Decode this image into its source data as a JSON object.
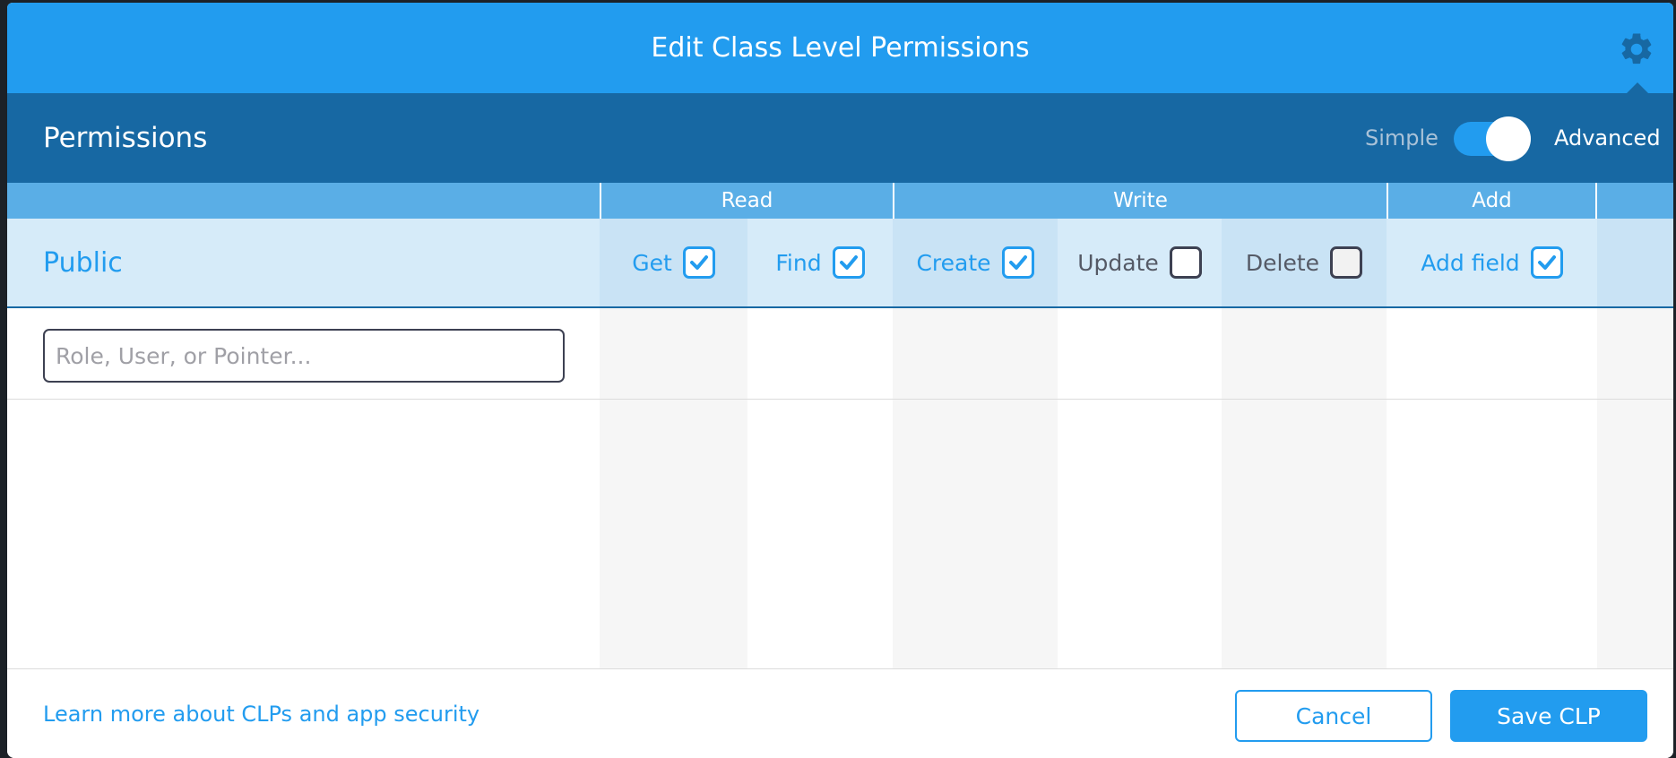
{
  "header": {
    "title": "Edit Class Level Permissions",
    "settings_icon": "gear-icon"
  },
  "subheader": {
    "title": "Permissions",
    "toggle": {
      "left_label": "Simple",
      "right_label": "Advanced",
      "state": "Advanced"
    }
  },
  "groups": [
    "Read",
    "Write",
    "Add"
  ],
  "public_row": {
    "label": "Public",
    "permissions": [
      {
        "label": "Get",
        "checked": true
      },
      {
        "label": "Find",
        "checked": true
      },
      {
        "label": "Create",
        "checked": true
      },
      {
        "label": "Update",
        "checked": false
      },
      {
        "label": "Delete",
        "checked": false
      },
      {
        "label": "Add field",
        "checked": true
      }
    ]
  },
  "input": {
    "placeholder": "Role, User, or Pointer...",
    "value": ""
  },
  "footer": {
    "link": "Learn more about CLPs and app security",
    "cancel_label": "Cancel",
    "save_label": "Save CLP"
  },
  "colors": {
    "accent": "#229cef",
    "dark": "#1768a3",
    "light": "#d6ebf9"
  }
}
